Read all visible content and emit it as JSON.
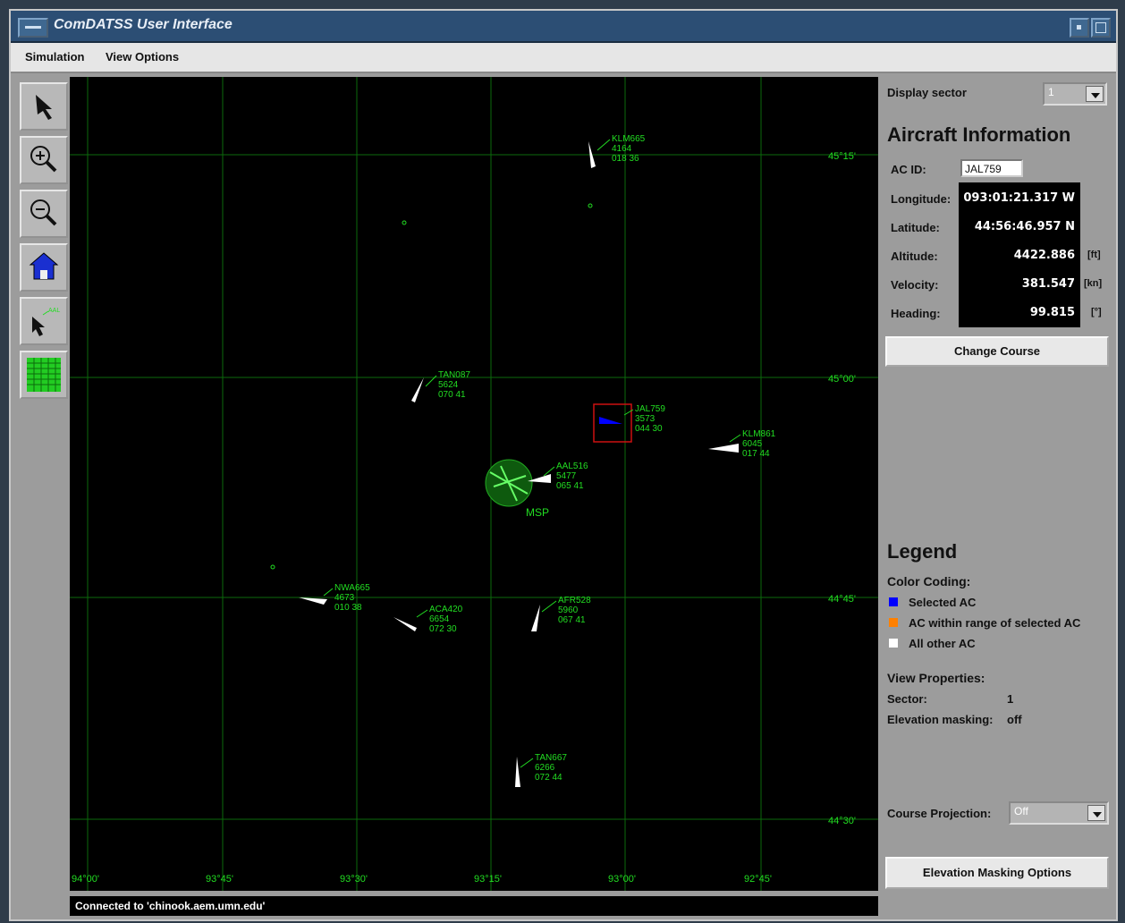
{
  "window": {
    "title": "ComDATSS User Interface"
  },
  "menu": {
    "simulation": "Simulation",
    "view_options": "View Options"
  },
  "toolbar": {
    "tools": [
      "pointer-arrow-icon",
      "zoom-in-icon",
      "zoom-out-icon",
      "home-icon",
      "aircraft-select-icon",
      "grid-toggle-icon"
    ]
  },
  "map": {
    "lat_labels": [
      "45°15'",
      "45°00'",
      "44°45'",
      "44°30'"
    ],
    "lon_labels": [
      "94°00'",
      "93°45'",
      "93°30'",
      "93°15'",
      "93°00'",
      "92°45'"
    ],
    "airport": "MSP",
    "aircraft": [
      {
        "id": "KLM665",
        "l2": "4164",
        "l3": "018 36",
        "selected": false
      },
      {
        "id": "TAN087",
        "l2": "5624",
        "l3": "070 41",
        "selected": false
      },
      {
        "id": "JAL759",
        "l2": "3573",
        "l3": "044 30",
        "selected": true
      },
      {
        "id": "KLM861",
        "l2": "6045",
        "l3": "017 44",
        "selected": false
      },
      {
        "id": "AAL516",
        "l2": "5477",
        "l3": "065 41",
        "selected": false
      },
      {
        "id": "NWA665",
        "l2": "4673",
        "l3": "010 38",
        "selected": false
      },
      {
        "id": "ACA420",
        "l2": "6654",
        "l3": "072 30",
        "selected": false
      },
      {
        "id": "AFR528",
        "l2": "5960",
        "l3": "067 41",
        "selected": false
      },
      {
        "id": "TAN667",
        "l2": "6266",
        "l3": "072 44",
        "selected": false
      }
    ]
  },
  "panel": {
    "display_sector_label": "Display sector",
    "display_sector_value": "1",
    "aircraft_info_title": "Aircraft Information",
    "ac_id_label": "AC ID:",
    "ac_id_value": "JAL759",
    "longitude_label": "Longitude:",
    "longitude_value": "093:01:21.317 W",
    "latitude_label": "Latitude:",
    "latitude_value": "44:56:46.957 N",
    "altitude_label": "Altitude:",
    "altitude_value": "4422.886",
    "altitude_unit": "[ft]",
    "velocity_label": "Velocity:",
    "velocity_value": "381.547",
    "velocity_unit": "[kn]",
    "heading_label": "Heading:",
    "heading_value": "99.815",
    "heading_unit": "[°]",
    "change_course": "Change Course",
    "legend_title": "Legend",
    "color_coding_title": "Color Coding:",
    "legend_selected": "Selected AC",
    "legend_in_range": "AC within range of selected AC",
    "legend_other": "All other AC",
    "colors": {
      "selected": "#0000ff",
      "in_range": "#ff8000",
      "other": "#ffffff",
      "map_green": "#22dd22"
    },
    "view_properties_title": "View Properties:",
    "sector_label": "Sector:",
    "sector_value": "1",
    "elevation_masking_label": "Elevation masking:",
    "elevation_masking_value": "off",
    "course_projection_label": "Course Projection:",
    "course_projection_value": "Off",
    "elevation_masking_button": "Elevation Masking Options"
  },
  "status": {
    "text": "Connected to 'chinook.aem.umn.edu'"
  }
}
